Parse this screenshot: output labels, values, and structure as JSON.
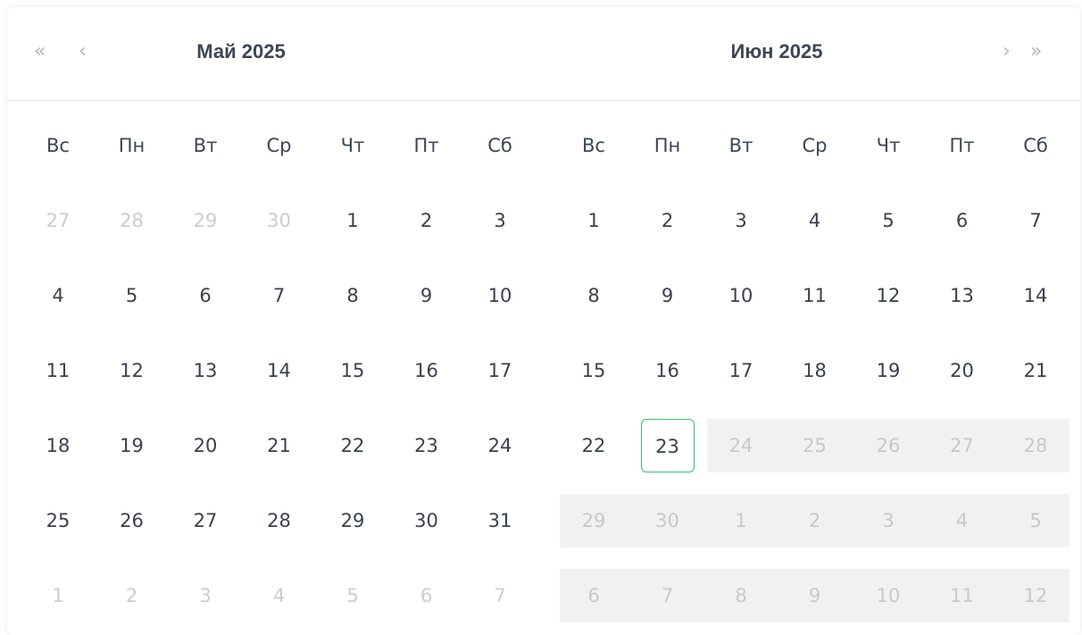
{
  "nav": {
    "prev_year": "«",
    "prev_month": "‹",
    "next_month": "›",
    "next_year": "»"
  },
  "months": [
    {
      "title": "Май  2025",
      "weekdays": [
        "Вс",
        "Пн",
        "Вт",
        "Ср",
        "Чт",
        "Пт",
        "Сб"
      ],
      "weeks": [
        [
          "27",
          "28",
          "29",
          "30",
          "1",
          "2",
          "3"
        ],
        [
          "4",
          "5",
          "6",
          "7",
          "8",
          "9",
          "10"
        ],
        [
          "11",
          "12",
          "13",
          "14",
          "15",
          "16",
          "17"
        ],
        [
          "18",
          "19",
          "20",
          "21",
          "22",
          "23",
          "24"
        ],
        [
          "25",
          "26",
          "27",
          "28",
          "29",
          "30",
          "31"
        ],
        [
          "1",
          "2",
          "3",
          "4",
          "5",
          "6",
          "7"
        ]
      ]
    },
    {
      "title": "Июн  2025",
      "weekdays": [
        "Вс",
        "Пн",
        "Вт",
        "Ср",
        "Чт",
        "Пт",
        "Сб"
      ],
      "weeks": [
        [
          "1",
          "2",
          "3",
          "4",
          "5",
          "6",
          "7"
        ],
        [
          "8",
          "9",
          "10",
          "11",
          "12",
          "13",
          "14"
        ],
        [
          "15",
          "16",
          "17",
          "18",
          "19",
          "20",
          "21"
        ],
        [
          "22",
          "23",
          "24",
          "25",
          "26",
          "27",
          "28"
        ],
        [
          "29",
          "30",
          "1",
          "2",
          "3",
          "4",
          "5"
        ],
        [
          "6",
          "7",
          "8",
          "9",
          "10",
          "11",
          "12"
        ]
      ]
    }
  ],
  "today": "23",
  "colors": {
    "today_border": "#34c56b",
    "disabled_bg": "#f1f1f1",
    "text": "#3a414c",
    "muted_text": "#c9ccd1"
  }
}
